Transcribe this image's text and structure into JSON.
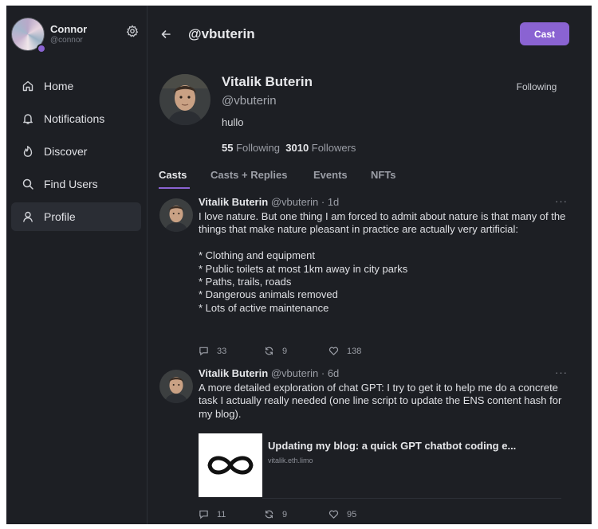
{
  "user": {
    "name": "Connor",
    "handle": "@connor"
  },
  "nav": [
    {
      "label": "Home",
      "icon": "home-icon"
    },
    {
      "label": "Notifications",
      "icon": "bell-icon"
    },
    {
      "label": "Discover",
      "icon": "flame-icon"
    },
    {
      "label": "Find Users",
      "icon": "search-icon"
    },
    {
      "label": "Profile",
      "icon": "person-icon",
      "active": true
    }
  ],
  "header": {
    "title": "@vbuterin",
    "cast_label": "Cast"
  },
  "profile": {
    "name": "Vitalik Buterin",
    "handle": "@vbuterin",
    "bio": "hullo",
    "following_count": "55",
    "following_label": "Following",
    "followers_count": "3010",
    "followers_label": "Followers",
    "follow_button": "Following"
  },
  "tabs": [
    {
      "label": "Casts",
      "active": true
    },
    {
      "label": "Casts + Replies"
    },
    {
      "label": "Events"
    },
    {
      "label": "NFTs"
    }
  ],
  "posts": [
    {
      "name": "Vitalik Buterin",
      "handle": "@vbuterin",
      "time": "· 1d",
      "more": "···",
      "body": "I love nature. But one thing I am forced to admit about nature is that many of the things that make nature pleasant in practice are actually very artificial:\n\n* Clothing and equipment\n* Public toilets at most 1km away in city parks\n* Paths, trails, roads\n* Dangerous animals removed\n* Lots of active maintenance",
      "replies": "33",
      "recasts": "9",
      "likes": "138"
    },
    {
      "name": "Vitalik Buterin",
      "handle": "@vbuterin",
      "time": "· 6d",
      "more": "···",
      "body": "A more detailed exploration of chat GPT: I try to get it to help me do a concrete task I actually really needed (one line script to update the ENS content hash for my blog).",
      "embed": {
        "title": "Updating my blog: a quick GPT chatbot coding e...",
        "domain": "vitalik.eth.limo"
      },
      "replies": "11",
      "recasts": "9",
      "likes": "95"
    }
  ],
  "colors": {
    "accent": "#8a63d2",
    "background": "#1d1f24"
  }
}
